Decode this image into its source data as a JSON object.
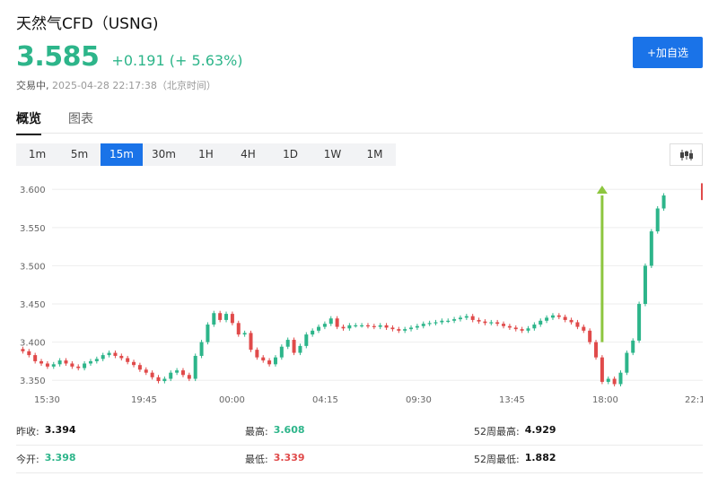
{
  "header": {
    "title": "天然气CFD（USNG)",
    "price": "3.585",
    "change": "+0.191 (+ 5.63%)",
    "status_label": "交易中,",
    "timestamp": "2025-04-28 22:17:38（北京时间）",
    "add_watchlist": "+加自选"
  },
  "tabs": [
    {
      "label": "概览",
      "active": true
    },
    {
      "label": "图表",
      "active": false
    }
  ],
  "intervals": [
    {
      "label": "1m",
      "active": false
    },
    {
      "label": "5m",
      "active": false
    },
    {
      "label": "15m",
      "active": true
    },
    {
      "label": "30m",
      "active": false
    },
    {
      "label": "1H",
      "active": false
    },
    {
      "label": "4H",
      "active": false
    },
    {
      "label": "1D",
      "active": false
    },
    {
      "label": "1W",
      "active": false
    },
    {
      "label": "1M",
      "active": false
    }
  ],
  "chart_data": {
    "type": "candlestick",
    "y_ticks": [
      "3.600",
      "3.550",
      "3.500",
      "3.450",
      "3.400",
      "3.350"
    ],
    "x_ticks": [
      "15:30",
      "19:45",
      "00:00",
      "04:15",
      "09:30",
      "13:45",
      "18:00",
      "22:1"
    ],
    "ylim": [
      3.335,
      3.612
    ],
    "colors": {
      "up": "#2db58a",
      "down": "#e04a4a",
      "arrow": "#8dc63f"
    },
    "closes": [
      3.388,
      3.383,
      3.375,
      3.372,
      3.368,
      3.371,
      3.376,
      3.372,
      3.368,
      3.366,
      3.372,
      3.375,
      3.378,
      3.383,
      3.386,
      3.382,
      3.379,
      3.374,
      3.37,
      3.364,
      3.36,
      3.354,
      3.349,
      3.352,
      3.36,
      3.363,
      3.357,
      3.352,
      3.382,
      3.4,
      3.423,
      3.438,
      3.429,
      3.437,
      3.425,
      3.41,
      3.412,
      3.39,
      3.38,
      3.376,
      3.371,
      3.38,
      3.394,
      3.403,
      3.386,
      3.395,
      3.41,
      3.415,
      3.42,
      3.424,
      3.431,
      3.42,
      3.418,
      3.422,
      3.422,
      3.422,
      3.421,
      3.42,
      3.422,
      3.419,
      3.417,
      3.415,
      3.417,
      3.419,
      3.421,
      3.424,
      3.425,
      3.426,
      3.428,
      3.428,
      3.43,
      3.432,
      3.434,
      3.429,
      3.427,
      3.425,
      3.426,
      3.424,
      3.421,
      3.419,
      3.417,
      3.415,
      3.418,
      3.423,
      3.428,
      3.432,
      3.435,
      3.433,
      3.429,
      3.426,
      3.42,
      3.415,
      3.4,
      3.38,
      3.348,
      3.352,
      3.345,
      3.36,
      3.386,
      3.402,
      3.45,
      3.5,
      3.545,
      3.575,
      3.592
    ]
  },
  "stats": [
    [
      {
        "label": "昨收:",
        "value": "3.394",
        "tone": ""
      },
      {
        "label": "最高:",
        "value": "3.608",
        "tone": "up"
      },
      {
        "label": "52周最高:",
        "value": "4.929",
        "tone": ""
      }
    ],
    [
      {
        "label": "今开:",
        "value": "3.398",
        "tone": "up"
      },
      {
        "label": "最低:",
        "value": "3.339",
        "tone": "down"
      },
      {
        "label": "52周最低:",
        "value": "1.882",
        "tone": ""
      }
    ]
  ]
}
